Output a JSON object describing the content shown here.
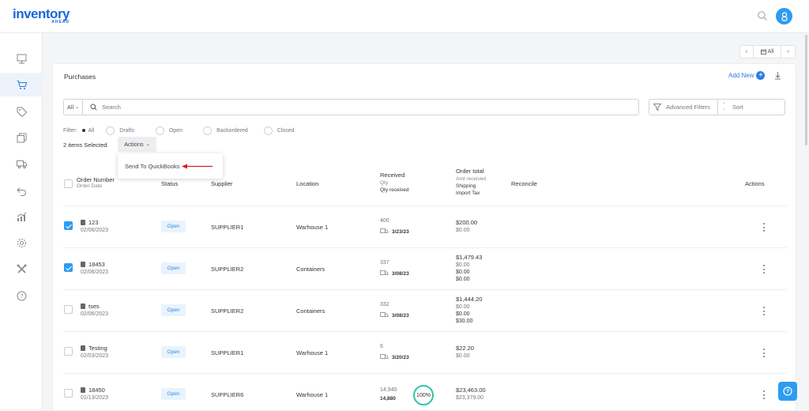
{
  "brand": {
    "name": "inventory",
    "tagline": "AHEAD"
  },
  "view_nav": {
    "label": "All"
  },
  "page": {
    "title": "Purchases",
    "add_new": "Add New"
  },
  "search": {
    "scope": "All",
    "placeholder": "Search"
  },
  "advanced_filters": "Advanced Filters",
  "sort": "Sort",
  "filter": {
    "label": "Filter:",
    "options": [
      "All",
      "Drafts",
      "Open",
      "Backordered",
      "Closed"
    ],
    "selected": "All"
  },
  "selection": {
    "count_text": "2 items Selected",
    "actions_label": "Actions"
  },
  "actions_menu": {
    "items": [
      "Send To QuickBooks"
    ]
  },
  "table": {
    "headers": {
      "order_number": "Order Number",
      "order_date": "Order Date",
      "status": "Status",
      "supplier": "Supplier",
      "location": "Location",
      "received": "Received",
      "received_qty": "Qty",
      "received_qty_received": "Qty received",
      "order_total": "Order total",
      "amt_received": "Amt received",
      "shipping": "Shipping",
      "import_tax": "Import Tax",
      "reconcile": "Reconcile",
      "actions": "Actions"
    },
    "rows": [
      {
        "number": "123",
        "date": "02/06/2023",
        "status": "Open",
        "supplier": "SUPPLIER1",
        "location": "Warhouse 1",
        "qty": "400",
        "received_date": "3/23/23",
        "total": "$200.00",
        "amt": "$0.00",
        "shipping": "",
        "tax": "",
        "checked": true
      },
      {
        "number": "18453",
        "date": "02/06/2023",
        "status": "Open",
        "supplier": "SUPPLIER2",
        "location": "Containers",
        "qty": "337",
        "received_date": "3/08/23",
        "total": "$1,479.43",
        "amt": "$0.00",
        "shipping": "$0.00",
        "tax": "$0.00",
        "checked": true
      },
      {
        "number": "tses",
        "date": "02/06/2023",
        "status": "Open",
        "supplier": "SUPPLIER2",
        "location": "Containers",
        "qty": "332",
        "received_date": "3/08/23",
        "total": "$1,444.20",
        "amt": "$0.00",
        "shipping": "$0.00",
        "tax": "$30.00",
        "checked": false
      },
      {
        "number": "Testing",
        "date": "02/03/2023",
        "status": "Open",
        "supplier": "SUPPLIER1",
        "location": "Warhouse 1",
        "qty": "6",
        "received_date": "3/20/23",
        "total": "$22.20",
        "amt": "$0.00",
        "shipping": "",
        "tax": "",
        "checked": false
      },
      {
        "number": "18450",
        "date": "01/13/2023",
        "status": "Open",
        "supplier": "SUPPLIER6",
        "location": "Warhouse 1",
        "qty": "14,940",
        "received_date": "14,880",
        "total": "$23,463.00",
        "amt": "$23,379.00",
        "shipping": "",
        "tax": "",
        "checked": false,
        "percent": "100%"
      }
    ]
  },
  "colors": {
    "brand": "#1c66d9",
    "accent": "#2d9cf0",
    "badge_bg": "#e9f3fd",
    "complete": "#2ec4a6"
  }
}
